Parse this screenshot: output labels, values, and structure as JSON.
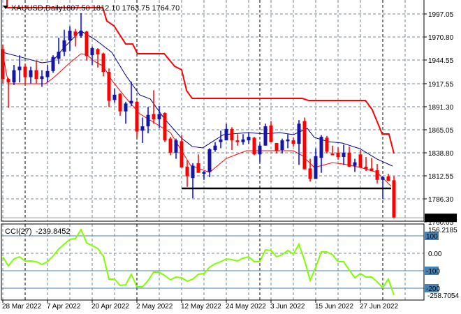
{
  "header": {
    "symbol_label": "XAUUSD,Daily",
    "ohlc_label": "1807.50 1812.10 1763.75 1764.70"
  },
  "colors": {
    "bull": "#1414a8",
    "bear": "#ff0000",
    "ma_fast": "#000080",
    "ma_slow": "#ff0000",
    "stop_line": "#ff0000",
    "cci": "#7fff00",
    "level": "#4682b4",
    "grid": "#778899"
  },
  "chart_data": [
    {
      "type": "candlestick",
      "title": "XAUUSD,Daily",
      "ylim": [
        1760.05,
        2013
      ],
      "y_ticks": [
        "1997.05",
        "1970.80",
        "1944.55",
        "1917.55",
        "1891.30",
        "1865.05",
        "1838.80",
        "1812.55",
        "1786.30",
        "1760.05"
      ],
      "y_tick_values": [
        1997.05,
        1970.8,
        1944.55,
        1917.55,
        1891.3,
        1865.05,
        1838.8,
        1812.55,
        1786.3,
        1760.05
      ],
      "current_price_label": "1764.70",
      "current_price": 1764.7,
      "x_labels": [
        "28 Mar 2022",
        "7 Apr 2022",
        "20 Apr 2022",
        "2 May 2022",
        "12 May 2022",
        "24 May 2022",
        "3 Jun 2022",
        "15 Jun 2022",
        "27 Jun 2022"
      ],
      "x_label_index": [
        0,
        8,
        16,
        24,
        32,
        40,
        48,
        56,
        64
      ],
      "month_separators": [
        4,
        24,
        46,
        68
      ],
      "ohlc": [
        [
          1957,
          1962,
          1918,
          1923
        ],
        [
          1923,
          1924,
          1890,
          1919
        ],
        [
          1919,
          1939,
          1916,
          1933
        ],
        [
          1933,
          1950,
          1919,
          1937
        ],
        [
          1937,
          1940,
          1918,
          1925
        ],
        [
          1925,
          1937,
          1918,
          1933
        ],
        [
          1933,
          1944,
          1918,
          1923
        ],
        [
          1923,
          1933,
          1914,
          1926
        ],
        [
          1925,
          1939,
          1919,
          1932
        ],
        [
          1932,
          1950,
          1930,
          1948
        ],
        [
          1946,
          1970,
          1940,
          1954
        ],
        [
          1954,
          1979,
          1949,
          1967
        ],
        [
          1967,
          1983,
          1955,
          1978
        ],
        [
          1977,
          1980,
          1960,
          1972
        ],
        [
          1972,
          1998,
          1970,
          1978
        ],
        [
          1977,
          1978,
          1944,
          1949
        ],
        [
          1950,
          1960,
          1939,
          1958
        ],
        [
          1957,
          1958,
          1936,
          1951
        ],
        [
          1952,
          1953,
          1926,
          1931
        ],
        [
          1931,
          1935,
          1891,
          1898
        ],
        [
          1899,
          1912,
          1896,
          1905
        ],
        [
          1906,
          1907,
          1881,
          1886
        ],
        [
          1886,
          1897,
          1872,
          1895
        ],
        [
          1895,
          1920,
          1892,
          1898
        ],
        [
          1897,
          1898,
          1856,
          1863
        ],
        [
          1864,
          1879,
          1850,
          1869
        ],
        [
          1869,
          1891,
          1861,
          1882
        ],
        [
          1883,
          1910,
          1872,
          1877
        ],
        [
          1877,
          1892,
          1867,
          1883
        ],
        [
          1884,
          1885,
          1851,
          1853
        ],
        [
          1855,
          1857,
          1836,
          1839
        ],
        [
          1839,
          1855,
          1832,
          1853
        ],
        [
          1852,
          1859,
          1822,
          1822
        ],
        [
          1823,
          1830,
          1800,
          1812
        ],
        [
          1810,
          1827,
          1787,
          1824
        ],
        [
          1827,
          1837,
          1816,
          1816
        ],
        [
          1815,
          1818,
          1808,
          1817
        ],
        [
          1817,
          1844,
          1811,
          1843
        ],
        [
          1842,
          1851,
          1840,
          1847
        ],
        [
          1851,
          1864,
          1844,
          1854
        ],
        [
          1853,
          1872,
          1853,
          1866
        ],
        [
          1866,
          1868,
          1842,
          1853
        ],
        [
          1853,
          1860,
          1847,
          1851
        ],
        [
          1851,
          1860,
          1848,
          1854
        ],
        [
          1853,
          1862,
          1849,
          1857
        ],
        [
          1856,
          1857,
          1836,
          1837
        ],
        [
          1837,
          1849,
          1828,
          1847
        ],
        [
          1847,
          1872,
          1847,
          1869
        ],
        [
          1870,
          1875,
          1851,
          1851
        ],
        [
          1850,
          1850,
          1838,
          1841
        ],
        [
          1842,
          1855,
          1838,
          1853
        ],
        [
          1852,
          1860,
          1844,
          1854
        ],
        [
          1853,
          1856,
          1846,
          1849
        ],
        [
          1849,
          1876,
          1825,
          1872
        ],
        [
          1875,
          1879,
          1820,
          1820
        ],
        [
          1821,
          1832,
          1806,
          1809
        ],
        [
          1809,
          1844,
          1809,
          1835
        ],
        [
          1833,
          1859,
          1816,
          1857
        ],
        [
          1856,
          1858,
          1838,
          1840
        ],
        [
          1838,
          1847,
          1836,
          1836
        ],
        [
          1839,
          1845,
          1831,
          1834
        ],
        [
          1834,
          1848,
          1825,
          1839
        ],
        [
          1839,
          1846,
          1823,
          1823
        ],
        [
          1824,
          1832,
          1817,
          1828
        ],
        [
          1837,
          1842,
          1822,
          1822
        ],
        [
          1823,
          1834,
          1818,
          1820
        ],
        [
          1821,
          1833,
          1818,
          1818
        ],
        [
          1819,
          1826,
          1804,
          1808
        ],
        [
          1808,
          1812,
          1786,
          1811
        ],
        [
          1812,
          1815,
          1807,
          1807
        ],
        [
          1807.5,
          1812.1,
          1763.75,
          1764.7
        ]
      ],
      "ma_fast": [
        [
          0,
          1953.3
        ],
        [
          2.9,
          1948.5
        ],
        [
          7,
          1941.4
        ],
        [
          8.9,
          1943.0
        ],
        [
          10.75,
          1957.3
        ],
        [
          13.9,
          1977.9
        ],
        [
          16.4,
          1968.4
        ],
        [
          19.5,
          1953.3
        ],
        [
          22,
          1927.1
        ],
        [
          24.5,
          1904.8
        ],
        [
          26.4,
          1900.1
        ],
        [
          28.9,
          1877.8
        ],
        [
          32,
          1855.5
        ],
        [
          33.9,
          1846.0
        ],
        [
          35.75,
          1844.4
        ],
        [
          39.5,
          1859.5
        ],
        [
          43.9,
          1861.9
        ],
        [
          47,
          1860.3
        ],
        [
          49.5,
          1861.9
        ],
        [
          52,
          1859.5
        ],
        [
          54.5,
          1866.6
        ],
        [
          55.75,
          1856.3
        ],
        [
          58.25,
          1851.5
        ],
        [
          60.75,
          1849.9
        ],
        [
          63.9,
          1843.5
        ],
        [
          67,
          1831.6
        ],
        [
          69.75,
          1823.7
        ]
      ],
      "ma_slow": [
        [
          0,
          1951.7
        ],
        [
          1,
          1917.5
        ],
        [
          7.6,
          1917.5
        ],
        [
          9,
          1923.9
        ],
        [
          12,
          1941.4
        ],
        [
          14,
          1951.7
        ],
        [
          15,
          1950.9
        ],
        [
          16.4,
          1943.0
        ],
        [
          18,
          1937.4
        ],
        [
          19.5,
          1921.5
        ],
        [
          22,
          1901.6
        ],
        [
          24.5,
          1883.3
        ],
        [
          30,
          1861.9
        ],
        [
          33.6,
          1824.5
        ],
        [
          37,
          1816.5
        ],
        [
          40,
          1832.4
        ],
        [
          43.6,
          1841.2
        ],
        [
          50.75,
          1841.2
        ],
        [
          52,
          1841.2
        ],
        [
          53.6,
          1835.6
        ],
        [
          55.75,
          1822.1
        ],
        [
          59,
          1827.6
        ],
        [
          61,
          1826.0
        ],
        [
          64,
          1822.1
        ],
        [
          67,
          1816.5
        ],
        [
          69.5,
          1800.6
        ]
      ],
      "stop_line": [
        [
          0.75,
          2013
        ],
        [
          0.75,
          2004.2
        ],
        [
          17.9,
          2004.2
        ],
        [
          18.6,
          1989.1
        ],
        [
          19.9,
          1983.5
        ],
        [
          22,
          1962.8
        ],
        [
          23.25,
          1962.8
        ],
        [
          24.1,
          1951.7
        ],
        [
          28.9,
          1951.7
        ],
        [
          30.75,
          1937.4
        ],
        [
          32,
          1933.4
        ],
        [
          32.9,
          1909.5
        ],
        [
          33.9,
          1900.8
        ],
        [
          53.6,
          1900.8
        ],
        [
          54.75,
          1898.4
        ],
        [
          64.9,
          1898.4
        ],
        [
          66.1,
          1888.1
        ],
        [
          67.9,
          1860.3
        ],
        [
          69.1,
          1860.3
        ],
        [
          70,
          1838.0
        ]
      ],
      "support_line": {
        "price": 1798.2,
        "from_index": 32,
        "to_index": 69.5
      }
    },
    {
      "type": "line",
      "title": "CCI(27)",
      "value_label": "-239.8452",
      "ylim": [
        -258.7054,
        156.2185
      ],
      "max_label": "156.2185",
      "min_label": "-258.7054",
      "levels": [
        {
          "value": 100,
          "label": "100"
        },
        {
          "value": -100,
          "label": "-100"
        },
        {
          "value": -200,
          "label": "-200"
        }
      ],
      "zero_label": "0.00",
      "values": [
        -20,
        -72,
        -32,
        -20,
        -44,
        -44,
        -48,
        -64,
        -48,
        -16,
        24,
        52,
        80,
        84,
        136,
        60,
        44,
        28,
        -16,
        -148,
        -148,
        -184,
        -180,
        -120,
        -192,
        -192,
        -156,
        -108,
        -108,
        -128,
        -152,
        -136,
        -140,
        -160,
        -148,
        -120,
        -116,
        -80,
        -60,
        -48,
        -32,
        -36,
        -44,
        -28,
        -20,
        -48,
        -48,
        20,
        16,
        -20,
        -8,
        16,
        -4,
        52,
        -40,
        -156,
        -80,
        8,
        8,
        -8,
        -48,
        -48,
        -96,
        -140,
        -116,
        -136,
        -136,
        -164,
        -196,
        -148,
        -239.8452
      ]
    }
  ]
}
